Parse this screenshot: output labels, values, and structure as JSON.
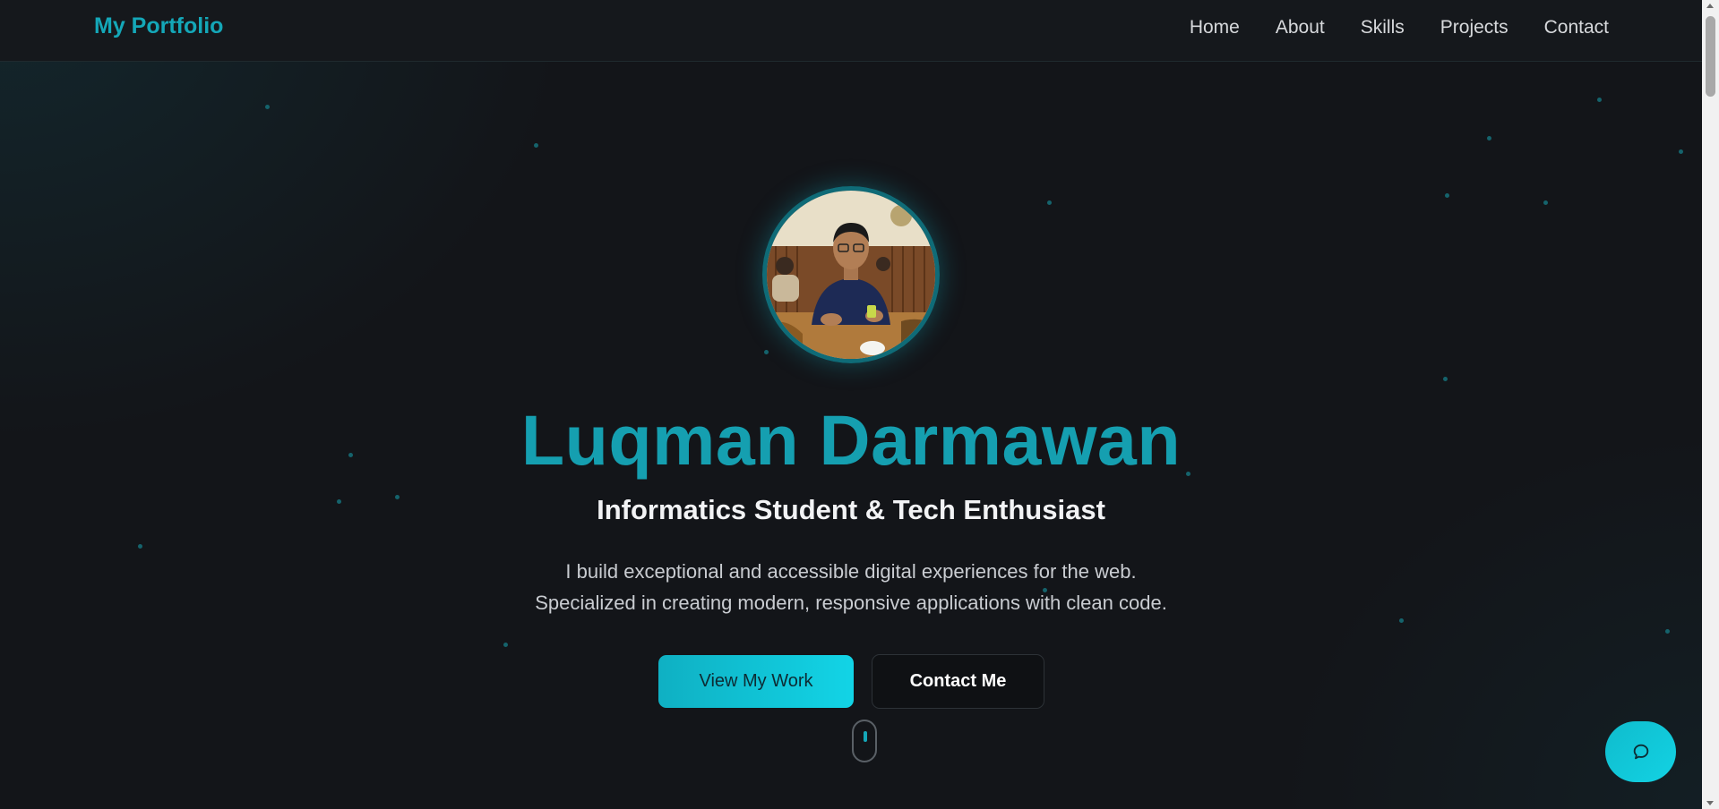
{
  "navbar": {
    "logo": "My Portfolio",
    "links": [
      "Home",
      "About",
      "Skills",
      "Projects",
      "Contact"
    ]
  },
  "hero": {
    "name": "Luqman Darmawan",
    "subtitle": "Informatics Student & Tech Enthusiast",
    "description_line1": "I build exceptional and accessible digital experiences for the web.",
    "description_line2": "Specialized in creating modern, responsive applications with clean code.",
    "primary_button": "View My Work",
    "secondary_button": "Contact Me"
  },
  "icons": {
    "chat": "chat-bubble-icon",
    "scroll": "mouse-scroll-icon"
  },
  "colors": {
    "accent": "#14a7b8",
    "button_gradient_start": "#0fb0c3",
    "button_gradient_end": "#12d4e6",
    "background": "#131519"
  }
}
